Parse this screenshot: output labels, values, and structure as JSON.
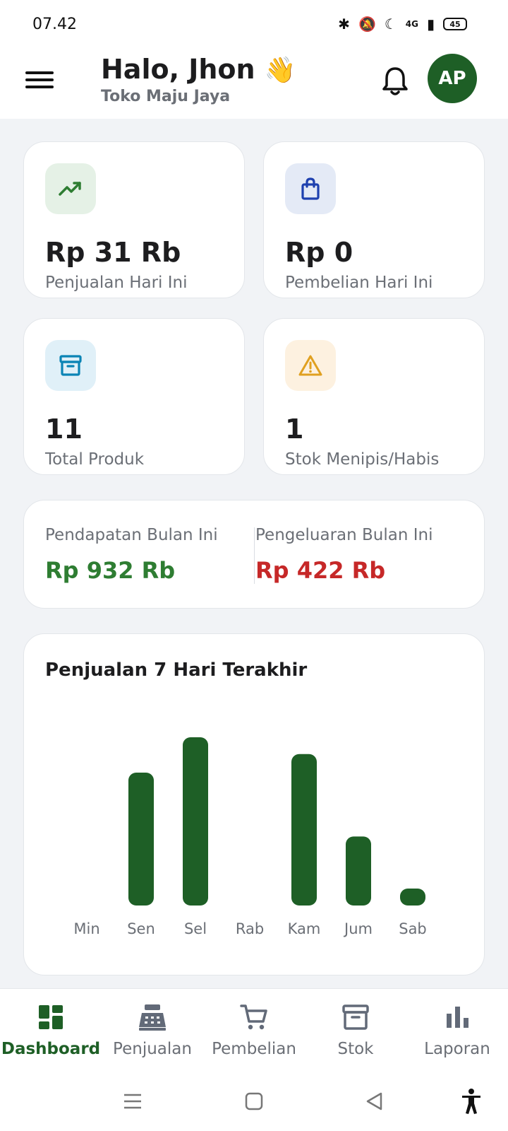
{
  "status_bar": {
    "time": "07.42",
    "network": "4G",
    "battery": "45"
  },
  "header": {
    "greeting": "Halo, Jhon",
    "emoji": "👋",
    "store_name": "Toko Maju Jaya",
    "avatar_initials": "AP"
  },
  "stats": [
    {
      "value": "Rp 31 Rb",
      "label": "Penjualan Hari Ini",
      "icon": "trending-up-icon",
      "color": "#2e7d32",
      "bg": "#e5f1e6"
    },
    {
      "value": "Rp 0",
      "label": "Pembelian Hari Ini",
      "icon": "shopping-bag-icon",
      "color": "#1e40af",
      "bg": "#e4eaf6"
    },
    {
      "value": "11",
      "label": "Total Produk",
      "icon": "archive-icon",
      "color": "#0b84b5",
      "bg": "#e0f0f8"
    },
    {
      "value": "1",
      "label": "Stok Menipis/Habis",
      "icon": "warning-icon",
      "color": "#e0a020",
      "bg": "#fdf1e0"
    }
  ],
  "monthly": {
    "income_label": "Pendapatan Bulan Ini",
    "income_value": "Rp 932 Rb",
    "expense_label": "Pengeluaran Bulan Ini",
    "expense_value": "Rp 422 Rb",
    "income_color": "#2e7d32",
    "expense_color": "#c62828"
  },
  "chart_data": {
    "type": "bar",
    "title": "Penjualan 7 Hari Terakhir",
    "categories": [
      "Min",
      "Sen",
      "Sel",
      "Rab",
      "Kam",
      "Jum",
      "Sab"
    ],
    "values": [
      0,
      0.79,
      1.0,
      0,
      0.9,
      0.41,
      0.1
    ],
    "color": "#1e5f26",
    "grid": false
  },
  "bottom_nav": [
    {
      "label": "Dashboard",
      "icon": "dashboard-icon",
      "active": true
    },
    {
      "label": "Penjualan",
      "icon": "cash-register-icon",
      "active": false
    },
    {
      "label": "Pembelian",
      "icon": "cart-icon",
      "active": false
    },
    {
      "label": "Stok",
      "icon": "archive-icon",
      "active": false
    },
    {
      "label": "Laporan",
      "icon": "bar-chart-icon",
      "active": false
    }
  ],
  "colors": {
    "primary": "#1e5f26",
    "background": "#f1f3f6",
    "muted": "#6b6f76"
  }
}
